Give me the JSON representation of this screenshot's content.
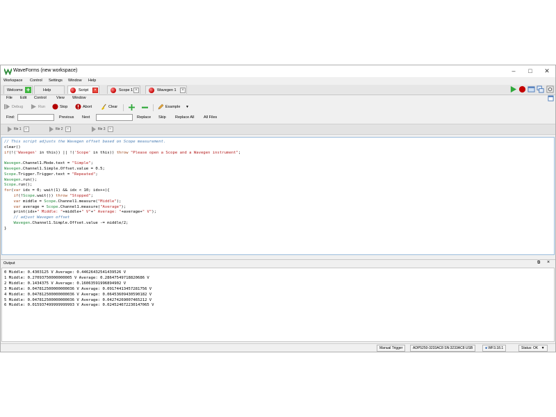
{
  "window": {
    "title": "WaveForms (new workspace)"
  },
  "menubar": [
    "Workspace",
    "Control",
    "Settings",
    "Window",
    "Help"
  ],
  "tabs": [
    {
      "label": "Welcome"
    },
    {
      "label": "Help"
    },
    {
      "label": "Script"
    },
    {
      "label": "Scope 1"
    },
    {
      "label": "Wavegen 1"
    }
  ],
  "script_menu": [
    "File",
    "Edit",
    "Control",
    "View",
    "Window"
  ],
  "toolbar": {
    "debug": "Debug",
    "run": "Run",
    "stop": "Stop",
    "abort": "Abort",
    "clear": "Clear",
    "example": "Example"
  },
  "find_bar": {
    "find_label": "Find:",
    "find_value": "",
    "previous": "Previous",
    "next": "Next",
    "replace_value": "",
    "replace": "Replace",
    "skip": "Skip",
    "replace_all": "Replace All",
    "all_files": "All Files"
  },
  "file_tabs": [
    "file 1",
    "file 2",
    "file 3"
  ],
  "code_lines": [
    [
      {
        "t": "// This script adjusts the Wavegen offset based on Scope measurement.",
        "c": "cm"
      }
    ],
    [
      {
        "t": "clear()",
        "c": ""
      }
    ],
    [
      {
        "t": "if",
        "c": "kw"
      },
      {
        "t": "(!(",
        "c": ""
      },
      {
        "t": "'Wavegen'",
        "c": "str"
      },
      {
        "t": " in this)) || !(",
        "c": ""
      },
      {
        "t": "'Scope'",
        "c": "str"
      },
      {
        "t": " in this)) ",
        "c": ""
      },
      {
        "t": "throw",
        "c": "kw"
      },
      {
        "t": " ",
        "c": ""
      },
      {
        "t": "\"Please open a Scope and a Wavegen instrument\"",
        "c": "str"
      },
      {
        "t": ";",
        "c": ""
      }
    ],
    [
      {
        "t": "",
        "c": ""
      }
    ],
    [
      {
        "t": "Wavegen",
        "c": "obj"
      },
      {
        "t": ".Channel1.Mode.text = ",
        "c": ""
      },
      {
        "t": "\"Simple\"",
        "c": "str"
      },
      {
        "t": ";",
        "c": ""
      }
    ],
    [
      {
        "t": "Wavegen",
        "c": "obj"
      },
      {
        "t": ".Channel1.Simple.Offset.value = 0.5;",
        "c": ""
      }
    ],
    [
      {
        "t": "Scope",
        "c": "obj"
      },
      {
        "t": ".Trigger.Trigger.text = ",
        "c": ""
      },
      {
        "t": "\"Repeated\"",
        "c": "str"
      },
      {
        "t": ";",
        "c": ""
      }
    ],
    [
      {
        "t": "Wavegen",
        "c": "obj"
      },
      {
        "t": ".run();",
        "c": ""
      }
    ],
    [
      {
        "t": "Scope",
        "c": "obj"
      },
      {
        "t": ".run();",
        "c": ""
      }
    ],
    [
      {
        "t": "for",
        "c": "kw"
      },
      {
        "t": "(",
        "c": ""
      },
      {
        "t": "var",
        "c": "kw"
      },
      {
        "t": " idx = 0; wait(1) && idx < 10; idx++){",
        "c": ""
      }
    ],
    [
      {
        "t": "    ",
        "c": ""
      },
      {
        "t": "if",
        "c": "kw"
      },
      {
        "t": "(!",
        "c": ""
      },
      {
        "t": "Scope",
        "c": "obj"
      },
      {
        "t": ".wait()) ",
        "c": ""
      },
      {
        "t": "throw",
        "c": "kw"
      },
      {
        "t": " ",
        "c": ""
      },
      {
        "t": "\"Stopped\"",
        "c": "str"
      },
      {
        "t": ";",
        "c": ""
      }
    ],
    [
      {
        "t": "    ",
        "c": ""
      },
      {
        "t": "var",
        "c": "kw"
      },
      {
        "t": " middle = ",
        "c": ""
      },
      {
        "t": "Scope",
        "c": "obj"
      },
      {
        "t": ".Channel1.measure(",
        "c": ""
      },
      {
        "t": "\"Middle\"",
        "c": "str"
      },
      {
        "t": ");",
        "c": ""
      }
    ],
    [
      {
        "t": "    ",
        "c": ""
      },
      {
        "t": "var",
        "c": "kw"
      },
      {
        "t": " average = ",
        "c": ""
      },
      {
        "t": "Scope",
        "c": "obj"
      },
      {
        "t": ".Channel1.measure(",
        "c": ""
      },
      {
        "t": "\"Average\"",
        "c": "str"
      },
      {
        "t": ");",
        "c": ""
      }
    ],
    [
      {
        "t": "    print(idx+",
        "c": ""
      },
      {
        "t": "\" Middle: \"",
        "c": "str"
      },
      {
        "t": "+middle+",
        "c": ""
      },
      {
        "t": "\" V\"",
        "c": "str"
      },
      {
        "t": "+",
        "c": ""
      },
      {
        "t": "\" Average: \"",
        "c": "str"
      },
      {
        "t": "+average+",
        "c": ""
      },
      {
        "t": "\" V\"",
        "c": "str"
      },
      {
        "t": ");",
        "c": ""
      }
    ],
    [
      {
        "t": "    // adjust Wavegen offset",
        "c": "cm"
      }
    ],
    [
      {
        "t": "    ",
        "c": ""
      },
      {
        "t": "Wavegen",
        "c": "obj"
      },
      {
        "t": ".Channel1.Simple.Offset.value -= middle/2;",
        "c": ""
      }
    ],
    [
      {
        "t": "}",
        "c": ""
      }
    ]
  ],
  "output": {
    "title": "Output",
    "lines": [
      "0 Middle: 0.4303125 V Average: 0.44626432541439526 V",
      "1 Middle: 0.27093750000000005 V Average: 0.28647549718820686 V",
      "2 Middle: 0.1434375 V Average: 0.16063591996894902 V",
      "3 Middle: 0.047812500000000036 V Average: 0.09174413457281756 V",
      "4 Middle: 0.047812500000000036 V Average: 0.06453609430590182 V",
      "5 Middle: 0.047812500000000036 V Average: 0.04274269007465212 V",
      "6 Middle: 0.015937499999999993 V Average: 0.024524672230147065 V"
    ]
  },
  "statusbar": {
    "trigger": "Manual Trigger",
    "device": "ADP5250-3233AC8 SN:3233AC8 USB",
    "version": "WF3.18.1",
    "status": "Status: OK"
  },
  "colors": {
    "run_green": "#2fa83a",
    "stop_red": "#c40000",
    "comment_blue": "#4a7db3",
    "string_red": "#b52020",
    "object_green": "#1f8a3a"
  }
}
